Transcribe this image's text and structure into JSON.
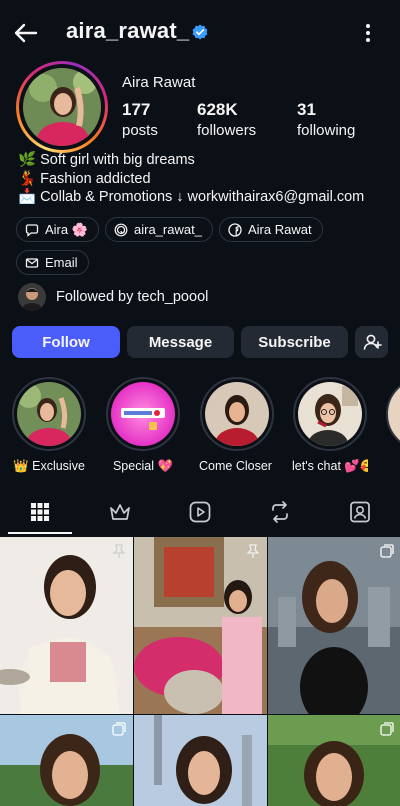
{
  "header": {
    "username": "aira_rawat_",
    "back_icon": "arrow-left-icon",
    "verified_icon": "verified-badge-icon",
    "menu_icon": "more-vertical-icon"
  },
  "profile": {
    "display_name": "Aira Rawat",
    "stats": [
      {
        "value": "177",
        "label": "posts"
      },
      {
        "value": "628K",
        "label": "followers"
      },
      {
        "value": "31",
        "label": "following"
      }
    ],
    "bio": [
      "🌿 Soft girl with big dreams",
      "💃 Fashion addicted",
      "📩 Collab & Promotions ↓ workwithairax6@gmail.com"
    ]
  },
  "chips": [
    {
      "label": "Aira 🌸",
      "icon": "threads-icon"
    },
    {
      "label": "aira_rawat_",
      "icon": "threads-at-icon"
    },
    {
      "label": "Aira Rawat",
      "icon": "facebook-icon"
    },
    {
      "label": "Email",
      "icon": "mail-icon"
    }
  ],
  "followed_by": "Followed by tech_poool",
  "actions": {
    "follow": "Follow",
    "message": "Message",
    "subscribe": "Subscribe",
    "add_user_icon": "add-person-icon"
  },
  "highlights": [
    {
      "label": "👑 Exclusive"
    },
    {
      "label": "Special 💖"
    },
    {
      "label": "Come Closer ..."
    },
    {
      "label": "let's chat 💕🥰"
    }
  ],
  "tabs": [
    "grid-icon",
    "crown-icon",
    "reels-icon",
    "repost-icon",
    "tagged-icon"
  ],
  "colors": {
    "background": "#0b0f16",
    "primary": "#4a5df9",
    "button": "#242a33",
    "verified": "#3b9cff"
  }
}
